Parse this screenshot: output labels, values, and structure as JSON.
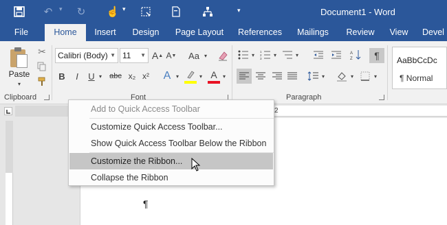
{
  "app": {
    "title": "Document1 - Word",
    "qat_icons": [
      "save-icon",
      "undo-icon",
      "redo-icon",
      "touch-mode-icon",
      "screenshot-icon",
      "new-page-icon",
      "org-chart-icon",
      "customize-qat-icon"
    ]
  },
  "tabs": [
    {
      "label": "File"
    },
    {
      "label": "Home"
    },
    {
      "label": "Insert"
    },
    {
      "label": "Design"
    },
    {
      "label": "Page Layout"
    },
    {
      "label": "References"
    },
    {
      "label": "Mailings"
    },
    {
      "label": "Review"
    },
    {
      "label": "View"
    },
    {
      "label": "Devel"
    }
  ],
  "ribbon": {
    "clipboard": {
      "paste_label": "Paste",
      "group_label": "Clipboard"
    },
    "font": {
      "font_name": "Calibri (Body)",
      "font_size": "11",
      "group_label": "Font",
      "grow_label": "A",
      "shrink_label": "A",
      "case_label": "Aa",
      "bold_label": "B",
      "italic_label": "I",
      "underline_label": "U",
      "strike_label": "abc",
      "sub_label": "x₂",
      "sup_label": "x²",
      "effects_label": "A",
      "highlight_label": "ab",
      "color_label": "A"
    },
    "paragraph": {
      "group_label": "Paragraph",
      "pilcrow": "¶"
    },
    "styles": {
      "sample": "AaBbCcDc",
      "name": "¶ Normal"
    }
  },
  "context_menu": {
    "items": [
      {
        "label": "Add to Quick Access Toolbar",
        "state": "disabled"
      },
      {
        "label": "Customize Quick Access Toolbar...",
        "state": "normal"
      },
      {
        "label": "Show Quick Access Toolbar Below the Ribbon",
        "state": "normal"
      },
      {
        "label": "Customize the Ribbon...",
        "state": "highlighted"
      },
      {
        "label": "Collapse the Ribbon",
        "state": "normal"
      }
    ]
  },
  "document": {
    "pilcrow": "¶",
    "ruler_mark": "2"
  },
  "colors": {
    "title_bar": "#2b579a",
    "ribbon": "#f1f1f1",
    "highlight_yellow": "#ffff00",
    "font_red": "#e81123"
  }
}
